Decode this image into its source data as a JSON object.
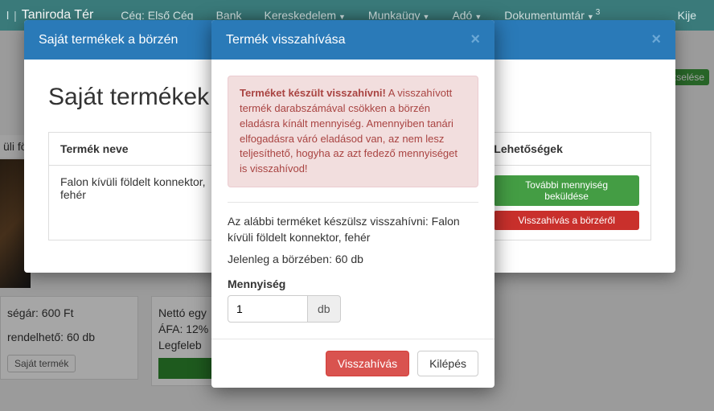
{
  "nav": {
    "brand_prefix": "l",
    "brand": "Taniroda Tér",
    "items": [
      "Cég: Első Cég",
      "Bank",
      "Kereskedelem",
      "Munkaügy",
      "Adó",
      "Dokumentumtár"
    ],
    "doc_badge": "3",
    "right": "Kije"
  },
  "bg": {
    "side_title": "üli fö",
    "card1": {
      "l1": "ségár: 600 Ft",
      "l2": "rendelhető: 60 db",
      "btn": "Saját termék"
    },
    "card2": {
      "l1": "Nettó egy",
      "l2": "ÁFA: 12%",
      "l3": "Legfeleb"
    },
    "topright_pill": "edzselése"
  },
  "modal1": {
    "title": "Saját termékek a börzén",
    "page_title": "Saját termékek",
    "th1": "Termék neve",
    "th2": "",
    "th3": "Lehetőségek",
    "td1": "Falon kívüli földelt konnektor, fehér",
    "btn_green": "További mennyiség beküldése",
    "btn_red": "Visszahívás a börzéről"
  },
  "modal2": {
    "title": "Termék visszahívása",
    "alert_strong": "Terméket készült visszahívni!",
    "alert_rest": " A visszahívott termék darabszámával csökken a börzén eladásra kínált mennyiség. Amennyiben tanári elfogadásra váró eladásod van, az nem lesz teljesíthető, hogyha az azt fedező mennyiséget is visszahívod!",
    "p1": "Az alábbi terméket készülsz visszahívni: Falon kívüli földelt konnektor, fehér",
    "p2": "Jelenleg a börzében: 60 db",
    "qty_label": "Mennyiség",
    "qty_value": "1",
    "qty_unit": "db",
    "btn_primary": "Visszahívás",
    "btn_cancel": "Kilépés"
  }
}
